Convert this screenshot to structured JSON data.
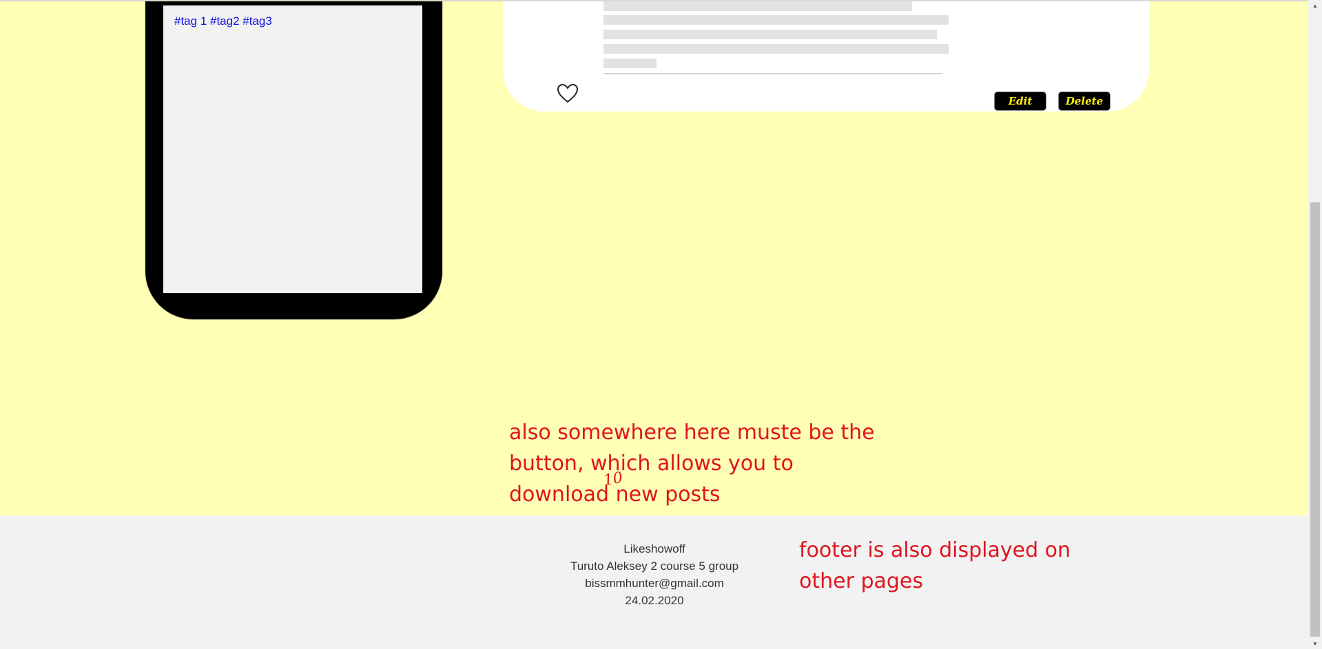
{
  "phone": {
    "tags": "#tag 1 #tag2 #tag3"
  },
  "post": {
    "edit_label": "Edit",
    "delete_label": "Delete",
    "like_icon": "heart-outline-icon"
  },
  "annotations": {
    "button_note": "also somewhere here muste be the button, which allows you to download new posts",
    "scribble": "10",
    "footer_note": "footer is also displayed on other pages"
  },
  "footer": {
    "site_name": "Likeshowoff",
    "author": "Turuto Aleksey 2 course 5 group",
    "email": "bissmmhunter@gmail.com",
    "date": "24.02.2020"
  },
  "colors": {
    "page_background": "#ffffb5",
    "button_text": "#ffef00",
    "annotation": "#e0141e",
    "tag_link": "#1010e0"
  },
  "scrollbar": {
    "up_icon": "triangle-up-icon",
    "down_icon": "triangle-down-icon"
  }
}
